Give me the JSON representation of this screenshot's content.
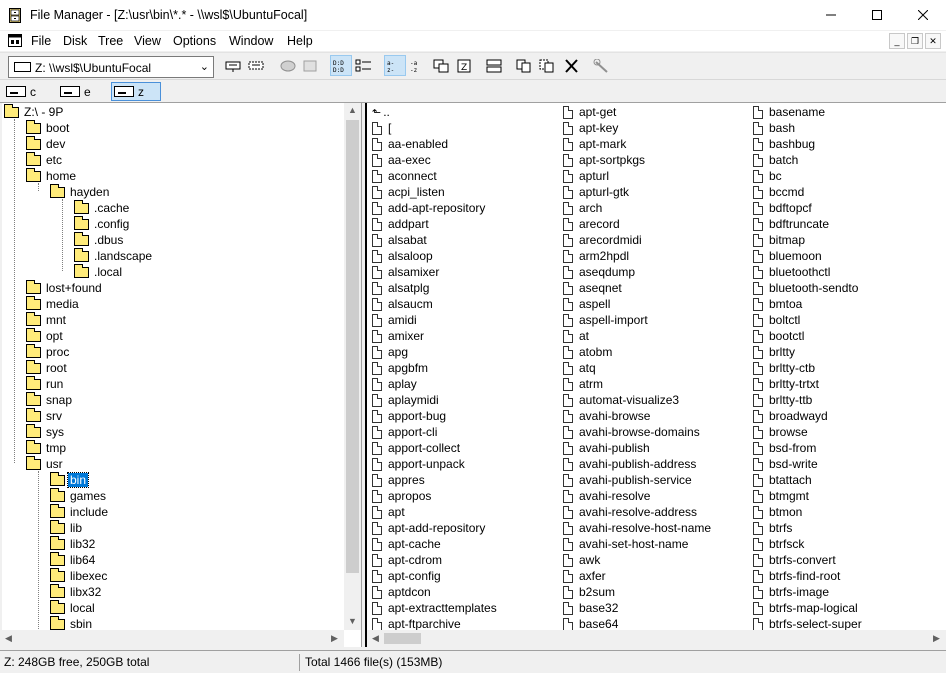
{
  "window": {
    "title": "File Manager - [Z:\\usr\\bin\\*.* - \\\\wsl$\\UbuntuFocal]"
  },
  "menu": [
    "File",
    "Disk",
    "Tree",
    "View",
    "Options",
    "Window",
    "Help"
  ],
  "toolbar": {
    "drive_select": "Z: \\\\wsl$\\UbuntuFocal",
    "buttons": [
      "connect-drive-icon",
      "disconnect-drive-icon",
      "share-icon",
      "stop-sharing-icon",
      "large-icons-view-icon",
      "details-view-icon",
      "sort-by-name-icon",
      "sort-by-type-icon",
      "new-window-icon",
      "tile-icon",
      "split-icon",
      "copy-icon",
      "move-icon",
      "delete-icon",
      "properties-icon"
    ]
  },
  "drives": [
    "c",
    "e",
    "z"
  ],
  "tree": {
    "root": "Z:\\ - 9P",
    "folders": [
      "boot",
      "dev",
      "etc",
      "home",
      "hayden",
      ".cache",
      ".config",
      ".dbus",
      ".landscape",
      ".local",
      "lost+found",
      "media",
      "mnt",
      "opt",
      "proc",
      "root",
      "run",
      "snap",
      "srv",
      "sys",
      "tmp",
      "usr",
      "bin",
      "games",
      "include",
      "lib",
      "lib32",
      "lib64",
      "libexec",
      "libx32",
      "local",
      "sbin"
    ],
    "selected": "bin"
  },
  "files": {
    "col1": [
      "..",
      "[",
      "aa-enabled",
      "aa-exec",
      "aconnect",
      "acpi_listen",
      "add-apt-repository",
      "addpart",
      "alsabat",
      "alsaloop",
      "alsamixer",
      "alsatplg",
      "alsaucm",
      "amidi",
      "amixer",
      "apg",
      "apgbfm",
      "aplay",
      "aplaymidi",
      "apport-bug",
      "apport-cli",
      "apport-collect",
      "apport-unpack",
      "appres",
      "apropos",
      "apt",
      "apt-add-repository",
      "apt-cache",
      "apt-cdrom",
      "apt-config",
      "aptdcon",
      "apt-extracttemplates",
      "apt-ftparchive"
    ],
    "col2": [
      "apt-get",
      "apt-key",
      "apt-mark",
      "apt-sortpkgs",
      "apturl",
      "apturl-gtk",
      "arch",
      "arecord",
      "arecordmidi",
      "arm2hpdl",
      "aseqdump",
      "aseqnet",
      "aspell",
      "aspell-import",
      "at",
      "atobm",
      "atq",
      "atrm",
      "automat-visualize3",
      "avahi-browse",
      "avahi-browse-domains",
      "avahi-publish",
      "avahi-publish-address",
      "avahi-publish-service",
      "avahi-resolve",
      "avahi-resolve-address",
      "avahi-resolve-host-name",
      "avahi-set-host-name",
      "awk",
      "axfer",
      "b2sum",
      "base32",
      "base64"
    ],
    "col3": [
      "basename",
      "bash",
      "bashbug",
      "batch",
      "bc",
      "bccmd",
      "bdftopcf",
      "bdftruncate",
      "bitmap",
      "bluemoon",
      "bluetoothctl",
      "bluetooth-sendto",
      "bmtoa",
      "boltctl",
      "bootctl",
      "brltty",
      "brltty-ctb",
      "brltty-trtxt",
      "brltty-ttb",
      "broadwayd",
      "browse",
      "bsd-from",
      "bsd-write",
      "btattach",
      "btmgmt",
      "btmon",
      "btrfs",
      "btrfsck",
      "btrfs-convert",
      "btrfs-find-root",
      "btrfs-image",
      "btrfs-map-logical",
      "btrfs-select-super"
    ]
  },
  "status": {
    "left": "Z: 248GB free,  250GB total",
    "right": "Total 1466 file(s) (153MB)"
  }
}
